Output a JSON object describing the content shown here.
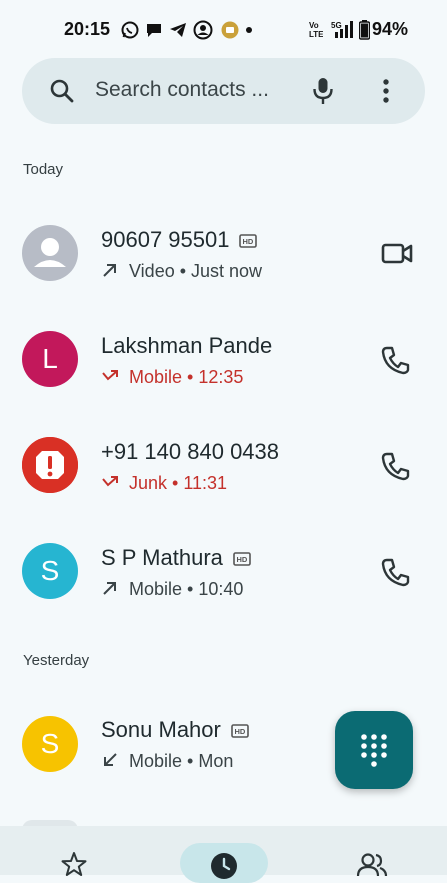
{
  "status_bar": {
    "time": "20:15",
    "battery": "94%",
    "icons": [
      "whatsapp-icon",
      "chat-icon",
      "telegram-icon",
      "account-icon",
      "notification-app-icon",
      "dot-icon",
      "volte-icon",
      "signal-5g-icon",
      "battery-icon"
    ]
  },
  "search": {
    "placeholder": "Search contacts ...",
    "icons": [
      "search-icon",
      "mic-icon",
      "more-vert-icon"
    ]
  },
  "sections": {
    "today": "Today",
    "yesterday": "Yesterday"
  },
  "calls": [
    {
      "name": "90607 95501",
      "direction_icon": "outgoing-arrow-icon",
      "detail": "Video • Just now",
      "hd": true,
      "action": "video-call-icon",
      "avatar_letter": "",
      "avatar_color": "#b7bcc6",
      "missed": false
    },
    {
      "name": "Lakshman Pande",
      "direction_icon": "missed-call-icon",
      "detail": "Mobile • 12:35",
      "hd": false,
      "action": "phone-icon",
      "avatar_letter": "L",
      "avatar_color": "#c2185b",
      "missed": true
    },
    {
      "name": "+91 140 840 0438",
      "direction_icon": "missed-call-icon",
      "detail": "Junk • 11:31",
      "hd": false,
      "action": "phone-icon",
      "avatar_letter": "",
      "avatar_color": "#d93025",
      "missed": true
    },
    {
      "name": "S P Mathura",
      "direction_icon": "outgoing-arrow-icon",
      "detail": "Mobile • 10:40",
      "hd": true,
      "action": "phone-icon",
      "avatar_letter": "S",
      "avatar_color": "#26b5d1",
      "missed": false
    },
    {
      "name": "Sonu Mahor",
      "direction_icon": "incoming-arrow-icon",
      "detail": "Mobile • Mon",
      "hd": true,
      "action": "",
      "avatar_letter": "S",
      "avatar_color": "#f7c300",
      "missed": false
    }
  ],
  "fab": {
    "icon": "dialpad-icon"
  },
  "bottom_nav": {
    "icons": [
      "star-icon",
      "clock-icon",
      "contacts-icon"
    ],
    "selected": "clock-icon"
  },
  "colors": {
    "accent": "#0b6b73",
    "missed": "#c4312b"
  }
}
